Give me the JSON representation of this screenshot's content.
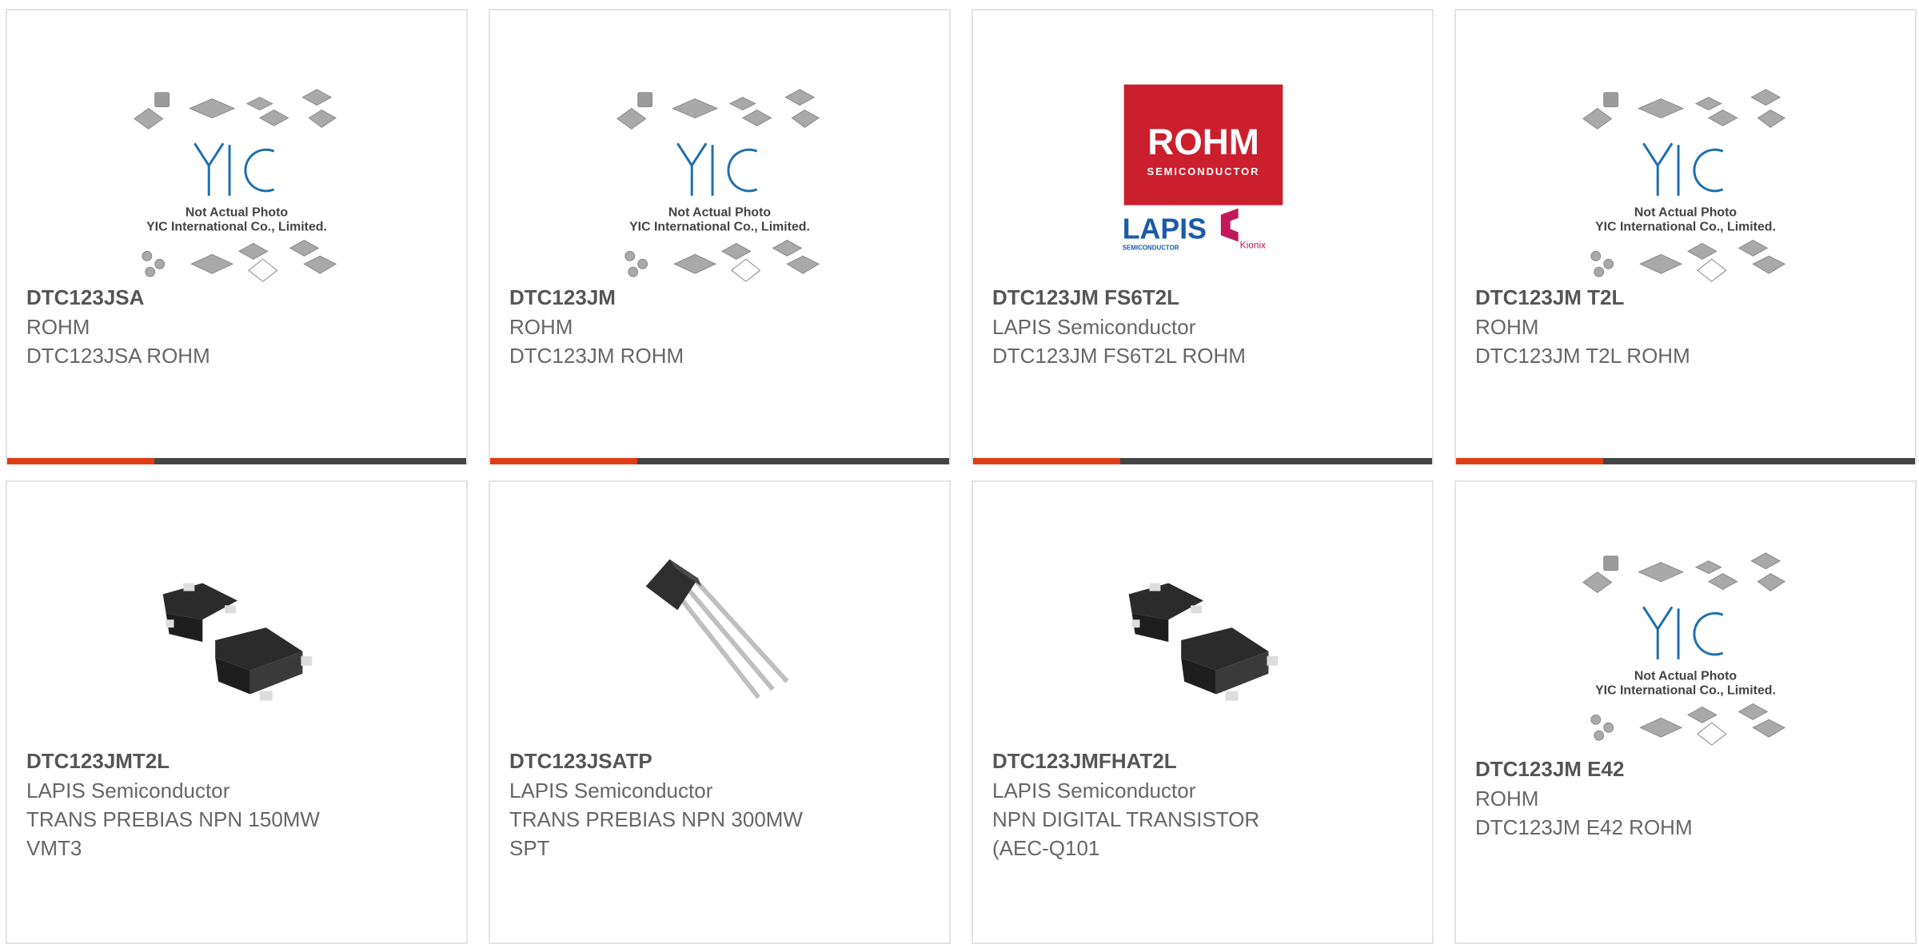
{
  "theme": {
    "accent": "#e03d14",
    "bar_dark": "#444444",
    "border": "#e3e3e3",
    "title_color": "#555555",
    "text_color": "#666666"
  },
  "placeholder": {
    "brand": "YIC",
    "caption1": "Not Actual Photo",
    "caption2": "YIC International Co., Limited."
  },
  "rohm_logo": {
    "brand": "ROHM",
    "sub": "SEMICONDUCTOR",
    "lapis": "LAPIS",
    "lapis_sub": "SEMICONDUCTOR",
    "kionix": "Kionix"
  },
  "products": [
    {
      "image": "placeholder",
      "part": "DTC123JSA",
      "maker": "ROHM",
      "desc1": "DTC123JSA ROHM",
      "desc2": ""
    },
    {
      "image": "placeholder",
      "part": "DTC123JM",
      "maker": "ROHM",
      "desc1": "DTC123JM ROHM",
      "desc2": ""
    },
    {
      "image": "rohm-logo",
      "part": "DTC123JM FS6T2L",
      "maker": "LAPIS Semiconductor",
      "desc1": "DTC123JM FS6T2L ROHM",
      "desc2": ""
    },
    {
      "image": "placeholder",
      "part": "DTC123JM T2L",
      "maker": "ROHM",
      "desc1": "DTC123JM T2L ROHM",
      "desc2": ""
    },
    {
      "image": "smd-transistor",
      "part": "DTC123JMT2L",
      "maker": "LAPIS Semiconductor",
      "desc1": "TRANS PREBIAS NPN 150MW",
      "desc2": "VMT3"
    },
    {
      "image": "to92-transistor",
      "part": "DTC123JSATP",
      "maker": "LAPIS Semiconductor",
      "desc1": "TRANS PREBIAS NPN 300MW",
      "desc2": "SPT"
    },
    {
      "image": "smd-transistor",
      "part": "DTC123JMFHAT2L",
      "maker": "LAPIS Semiconductor",
      "desc1": "NPN DIGITAL TRANSISTOR",
      "desc2": "(AEC-Q101"
    },
    {
      "image": "placeholder",
      "part": "DTC123JM E42",
      "maker": "ROHM",
      "desc1": "DTC123JM E42 ROHM",
      "desc2": ""
    }
  ]
}
